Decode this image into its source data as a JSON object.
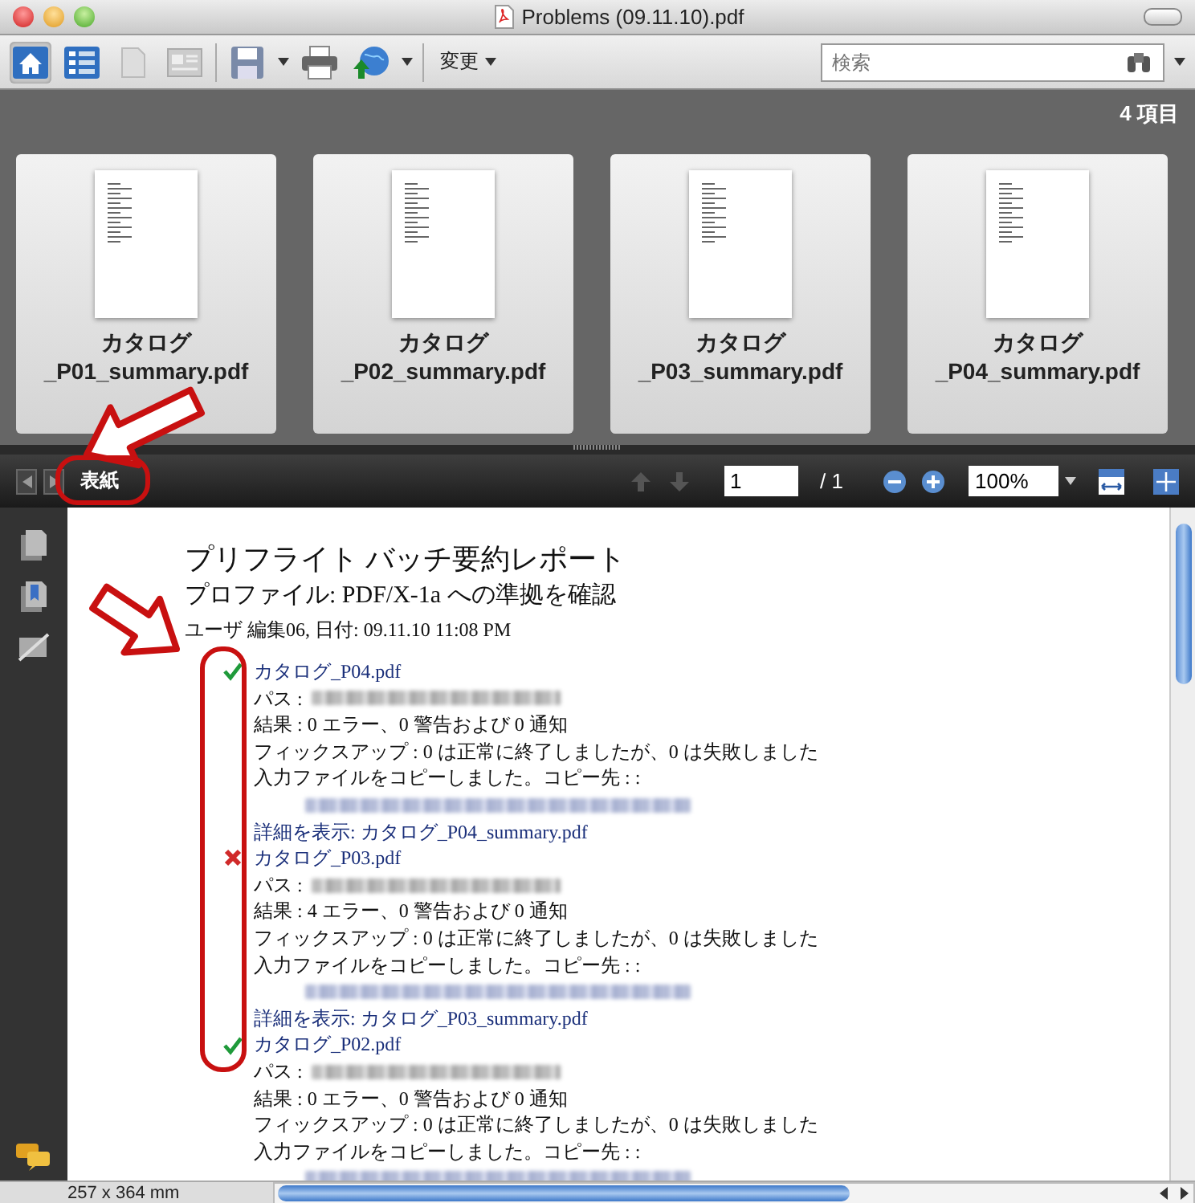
{
  "window": {
    "title": "Problems (09.11.10).pdf"
  },
  "toolbar": {
    "change_menu": "変更",
    "search": {
      "placeholder": "検索"
    }
  },
  "thumbnails": {
    "count": "4 項目",
    "items": [
      {
        "label": "カタログ_P01_summary.pdf"
      },
      {
        "label": "カタログ_P02_summary.pdf"
      },
      {
        "label": "カタログ_P03_summary.pdf"
      },
      {
        "label": "カタログ_P04_summary.pdf"
      }
    ]
  },
  "viewer_toolbar": {
    "section": "表紙",
    "page": "1",
    "page_total": "/ 1",
    "zoom": "100%"
  },
  "document": {
    "title": "プリフライト バッチ要約レポート",
    "profile": "プロファイル: PDF/X-1a への準拠を確認",
    "user": "ユーザ 編集06, 日付: 09.11.10 11:08 PM",
    "entries": [
      {
        "kind": "ok",
        "name": "カタログ_P04.pdf",
        "path_label": "パス :",
        "result": "結果 : 0 エラー、0 警告および 0 通知",
        "fixup": "フィックスアップ : 0 は正常に終了しましたが、0 は失敗しました",
        "copy_label": "入力ファイルをコピーしました。コピー先 : :",
        "detail": "詳細を表示: カタログ_P04_summary.pdf"
      },
      {
        "kind": "error",
        "name": "カタログ_P03.pdf",
        "path_label": "パス :",
        "result": "結果 : 4 エラー、0 警告および 0 通知",
        "fixup": "フィックスアップ : 0 は正常に終了しましたが、0 は失敗しました",
        "copy_label": "入力ファイルをコピーしました。コピー先 : :",
        "detail": "詳細を表示: カタログ_P03_summary.pdf"
      },
      {
        "kind": "ok",
        "name": "カタログ_P02.pdf",
        "path_label": "パス :",
        "result": "結果 : 0 エラー、0 警告および 0 通知",
        "fixup": "フィックスアップ : 0 は正常に終了しましたが、0 は失敗しました",
        "copy_label": "入力ファイルをコピーしました。コピー先 : :"
      }
    ]
  },
  "status_bar": {
    "size": "257 x 364 mm"
  }
}
